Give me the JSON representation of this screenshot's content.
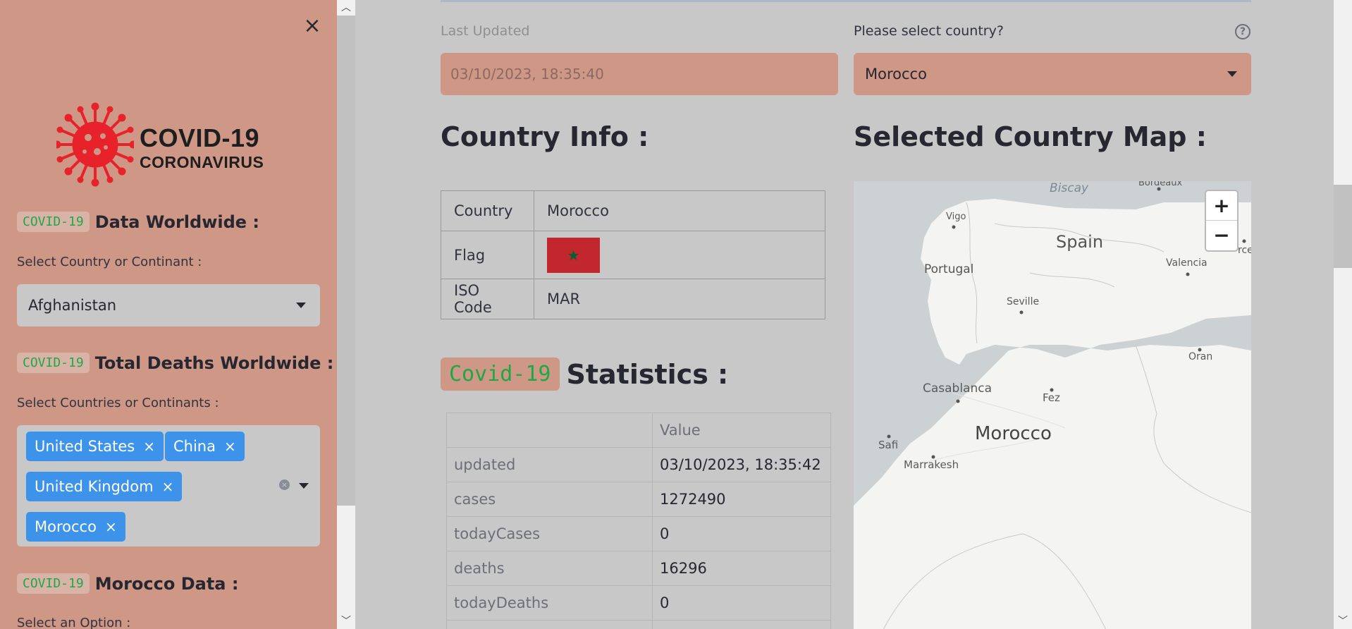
{
  "sidebar": {
    "close_label": "×",
    "logo": {
      "line1": "COVID-19",
      "line2": "CORONAVIRUS"
    },
    "sections": [
      {
        "tag": "COVID-19",
        "title": "Data Worldwide :"
      },
      {
        "tag": "COVID-19",
        "title": "Total Deaths Worldwide :"
      },
      {
        "tag": "COVID-19",
        "title": "Morocco Data :"
      }
    ],
    "select_country_label": "Select Country or Continant :",
    "select_country_value": "Afghanistan",
    "select_countries_label": "Select Countries or Continants :",
    "selected_countries": [
      "United States",
      "China",
      "United Kingdom",
      "Morocco"
    ],
    "chip_remove": "×",
    "select_option_label": "Select an Option :"
  },
  "main": {
    "last_updated_label": "Last Updated",
    "last_updated_value": "03/10/2023, 18:35:40",
    "select_country_label": "Please select country?",
    "select_country_value": "Morocco",
    "help_icon": "?",
    "country_info_title": "Country Info :",
    "map_title": "Selected Country Map :",
    "country_info": {
      "country_key": "Country",
      "country_value": "Morocco",
      "flag_key": "Flag",
      "flag_glyph": "★",
      "iso_key": "ISO Code",
      "iso_value": "MAR"
    },
    "stats_tag": "Covid-19",
    "stats_title": "Statistics :",
    "stats_header_value": "Value",
    "stats_rows": [
      {
        "key": "updated",
        "value": "03/10/2023, 18:35:42"
      },
      {
        "key": "cases",
        "value": "1272490"
      },
      {
        "key": "todayCases",
        "value": "0"
      },
      {
        "key": "deaths",
        "value": "16296"
      },
      {
        "key": "todayDeaths",
        "value": "0"
      }
    ]
  },
  "map": {
    "labels": {
      "biscay": "Biscay",
      "bordeaux": "Bordeaux",
      "vigo": "Vigo",
      "spain": "Spain",
      "portugal": "Portugal",
      "valencia": "Valencia",
      "seville": "Seville",
      "oran": "Oran",
      "casablanca": "Casablanca",
      "fez": "Fez",
      "morocco": "Morocco",
      "safi": "Safi",
      "marrakesh": "Marrakesh",
      "barcelona_partial": "rce"
    },
    "zoom_in": "+",
    "zoom_out": "−"
  },
  "colors": {
    "sidebar_bg": "#cf9786",
    "main_bg": "#c8c8c8",
    "chip_bg": "#3d93ea",
    "tag_text": "#1fa84a",
    "logo_red": "#e8222a"
  },
  "icons": {
    "close": "close-icon",
    "help": "help-icon",
    "caret": "chevron-down-icon",
    "logo": "virus-icon"
  }
}
